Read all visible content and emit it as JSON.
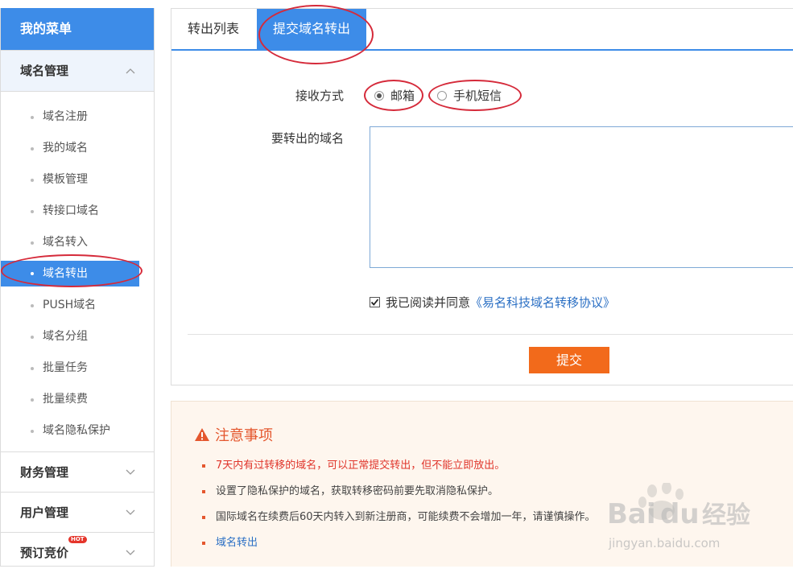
{
  "sidebar": {
    "title": "我的菜单",
    "groups": {
      "domain": {
        "label": "域名管理"
      },
      "finance": {
        "label": "财务管理"
      },
      "user": {
        "label": "用户管理"
      },
      "auction": {
        "label": "预订竞价",
        "badge": "HOT"
      }
    },
    "items": [
      "域名注册",
      "我的域名",
      "模板管理",
      "转接口域名",
      "域名转入",
      "域名转出",
      "PUSH域名",
      "域名分组",
      "批量任务",
      "批量续费",
      "域名隐私保护"
    ],
    "active_item": "域名转出"
  },
  "tabs": {
    "list": "转出列表",
    "submit": "提交域名转出"
  },
  "form": {
    "receive_label": "接收方式",
    "options": {
      "email": "邮箱",
      "sms": "手机短信"
    },
    "selected": "邮箱",
    "domains_label": "要转出的域名",
    "domains_value": "",
    "agree_prefix": "我已阅读并同意",
    "agree_link": "《易名科技域名转移协议》",
    "agree_checked": true,
    "submit_label": "提交"
  },
  "notice": {
    "title": "注意事项",
    "items": [
      "7天内有过转移的域名，可以正常提交转出，但不能立即放出。",
      "设置了隐私保护的域名，获取转移密码前要先取消隐私保护。",
      "国际域名在续费后60天内转入到新注册商，可能续费不会增加一年，请谨慎操作。",
      "域名转出"
    ]
  },
  "watermark": {
    "brand": "Bai",
    "brand_suffix": "du",
    "cn": "经验",
    "url": "jingyan.baidu.com"
  },
  "colors": {
    "accent": "#3d8ce8",
    "submit": "#f26a1b",
    "annotation": "#d52a3a",
    "warning": "#e4572e"
  }
}
